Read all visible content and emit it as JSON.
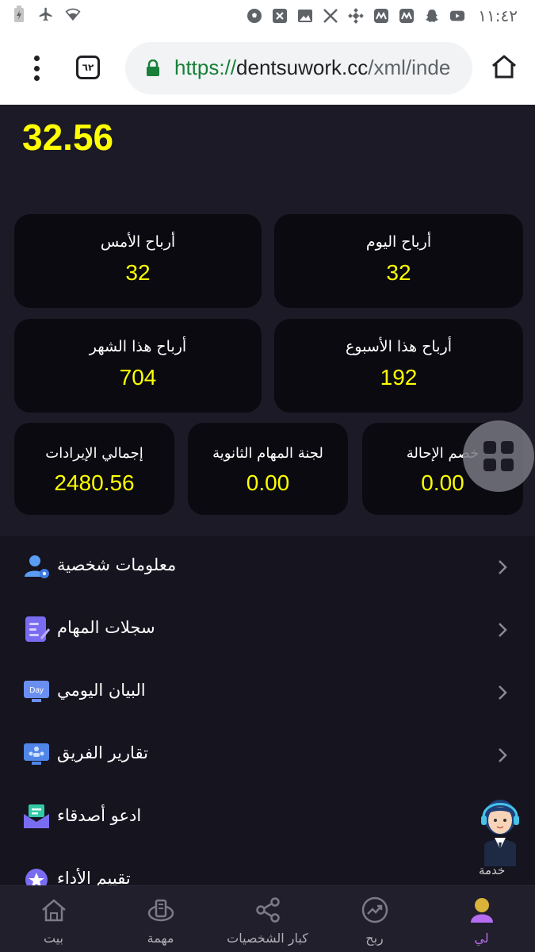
{
  "status_bar": {
    "time": "١١:٤٢",
    "left_icons": [
      "battery-charging-icon",
      "airplane-mode-icon",
      "wifi-icon"
    ],
    "right_icons": [
      "soccer-ball-icon",
      "x-box-icon",
      "image-icon",
      "x-twitter-icon",
      "binance-icon",
      "mega-icon",
      "mega-icon-2",
      "snapchat-icon",
      "youtube-icon"
    ]
  },
  "browser": {
    "tab_count": "٦٢",
    "url_scheme": "https://",
    "url_host": "dentsuwork.cc",
    "url_path": "/xml/inde"
  },
  "balance": "32.56",
  "stats": {
    "today_label": "أرباح اليوم",
    "today_value": "32",
    "yesterday_label": "أرباح الأمس",
    "yesterday_value": "32",
    "week_label": "أرباح هذا الأسبوع",
    "week_value": "192",
    "month_label": "أرباح هذا الشهر",
    "month_value": "704",
    "referral_label": "خصم الإحالة",
    "referral_value": "0.00",
    "secondary_label": "لجنة المهام الثانوية",
    "secondary_value": "0.00",
    "total_label": "إجمالي الإيرادات",
    "total_value": "2480.56"
  },
  "menu": {
    "items": [
      {
        "label": "معلومات شخصية",
        "icon": "user-settings-icon"
      },
      {
        "label": "سجلات المهام",
        "icon": "task-records-icon"
      },
      {
        "label": "البيان اليومي",
        "icon": "day-monitor-icon"
      },
      {
        "label": "تقارير الفريق",
        "icon": "team-report-icon"
      },
      {
        "label": "ادعو أصدقاء",
        "icon": "invite-mail-icon"
      },
      {
        "label": "تقييم الأداء",
        "icon": "performance-star-icon"
      }
    ],
    "day_text": "Day"
  },
  "support_label": "خدمة",
  "bottom_nav": {
    "home": "بيت",
    "task": "مهمة",
    "vip": "كبار الشخصيات",
    "profit": "ربح",
    "me": "لي"
  },
  "colors": {
    "accent_yellow": "#ffff00",
    "active_purple": "#b56cf0",
    "background": "#1b1a26",
    "card": "#0a0a10"
  }
}
